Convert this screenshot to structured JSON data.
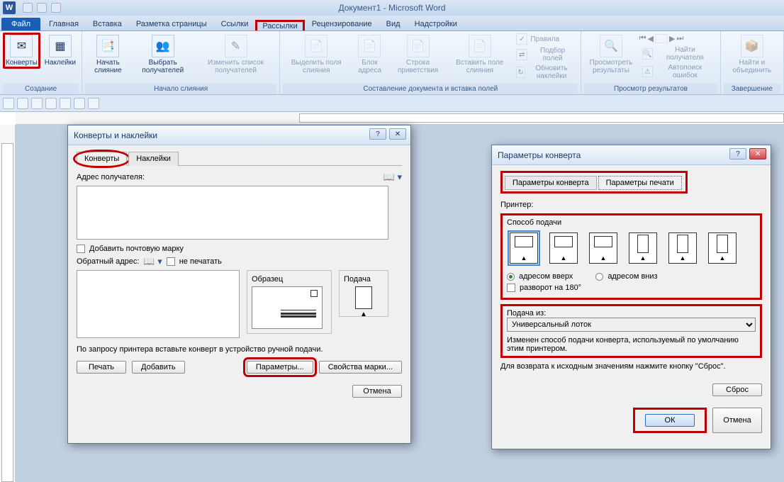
{
  "window": {
    "title": "Документ1 - Microsoft Word"
  },
  "tabs": {
    "file": "Файл",
    "home": "Главная",
    "insert": "Вставка",
    "layout": "Разметка страницы",
    "references": "Ссылки",
    "mailings": "Рассылки",
    "review": "Рецензирование",
    "view": "Вид",
    "addins": "Надстройки"
  },
  "ribbon": {
    "create": {
      "label": "Создание",
      "envelopes": "Конверты",
      "labels": "Наклейки"
    },
    "start_merge": {
      "label": "Начало слияния",
      "start": "Начать слияние",
      "select": "Выбрать получателей",
      "edit": "Изменить список получателей"
    },
    "write_fields": {
      "label": "Составление документа и вставка полей",
      "highlight": "Выделить поля слияния",
      "address": "Блок адреса",
      "greeting": "Строка приветствия",
      "insert": "Вставить поле слияния",
      "rules": "Правила",
      "match": "Подбор полей",
      "update": "Обновить наклейки"
    },
    "preview": {
      "label": "Просмотр результатов",
      "preview": "Просмотреть результаты",
      "find": "Найти получателя",
      "errors": "Автопоиск ошибок"
    },
    "finish": {
      "label": "Завершение",
      "finish": "Найти и объединить"
    }
  },
  "dialog1": {
    "title": "Конверты и наклейки",
    "tab_env": "Конверты",
    "tab_labels": "Наклейки",
    "recipient_label": "Адрес получателя:",
    "add_stamp": "Добавить почтовую марку",
    "return_label": "Обратный адрес:",
    "no_print": "не печатать",
    "sample": "Образец",
    "feed": "Подача",
    "hint": "По запросу принтера вставьте конверт в устройство ручной подачи.",
    "print": "Печать",
    "add": "Добавить",
    "params": "Параметры...",
    "stamp_props": "Свойства марки...",
    "cancel": "Отмена"
  },
  "dialog2": {
    "title": "Параметры конверта",
    "tab_env": "Параметры конверта",
    "tab_print": "Параметры  печати",
    "printer_label": "Принтер:",
    "feed_method": "Способ подачи",
    "addr_up": "адресом вверх",
    "addr_down": "адресом вниз",
    "rotate": "разворот на 180°",
    "tray_label": "Подача из:",
    "tray_value": "Универсальный лоток",
    "note1": "Изменен способ подачи конверта, используемый по умолчанию этим принтером.",
    "note2": "Для возврата к исходным значениям нажмите кнопку \"Сброс\".",
    "reset": "Сброс",
    "ok": "ОК",
    "cancel": "Отмена"
  }
}
